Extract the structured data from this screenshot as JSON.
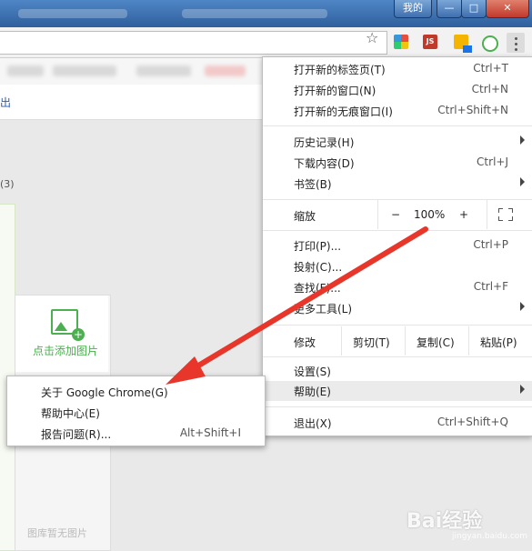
{
  "window": {
    "user_button": "我的",
    "minimize_glyph": "—",
    "maximize_glyph": "□",
    "close_glyph": "✕"
  },
  "toolbar": {
    "star_icon": "star-icon",
    "ext2_label": "JS"
  },
  "page": {
    "exit_text": "出",
    "count_text": "(3)",
    "add_image_label": "点击添加图片",
    "no_image_text": "图库暂无图片"
  },
  "menu": {
    "items": [
      {
        "label": "打开新的标签页(T)",
        "shortcut": "Ctrl+T"
      },
      {
        "label": "打开新的窗口(N)",
        "shortcut": "Ctrl+N"
      },
      {
        "label": "打开新的无痕窗口(I)",
        "shortcut": "Ctrl+Shift+N"
      },
      {
        "label": "历史记录(H)",
        "shortcut": ""
      },
      {
        "label": "下载内容(D)",
        "shortcut": "Ctrl+J"
      },
      {
        "label": "书签(B)",
        "shortcut": ""
      },
      {
        "label": "打印(P)...",
        "shortcut": "Ctrl+P"
      },
      {
        "label": "投射(C)...",
        "shortcut": ""
      },
      {
        "label": "查找(F)...",
        "shortcut": "Ctrl+F"
      },
      {
        "label": "更多工具(L)",
        "shortcut": ""
      },
      {
        "label": "设置(S)",
        "shortcut": ""
      },
      {
        "label": "帮助(E)",
        "shortcut": ""
      },
      {
        "label": "退出(X)",
        "shortcut": "Ctrl+Shift+Q"
      }
    ],
    "zoom": {
      "label": "缩放",
      "minus": "−",
      "value": "100%",
      "plus": "+"
    },
    "edit": {
      "label": "修改",
      "cut": "剪切(T)",
      "copy": "复制(C)",
      "paste": "粘贴(P)"
    }
  },
  "submenu": {
    "items": [
      {
        "label": "关于 Google Chrome(G)",
        "shortcut": ""
      },
      {
        "label": "帮助中心(E)",
        "shortcut": ""
      },
      {
        "label": "报告问题(R)...",
        "shortcut": "Alt+Shift+I"
      }
    ]
  },
  "watermark": {
    "brand": "Bai经验",
    "url": "jingyan.baidu.com"
  },
  "colors": {
    "arrow": "#e8362b",
    "accent_green": "#4caf50",
    "link_blue": "#2a5db0"
  }
}
